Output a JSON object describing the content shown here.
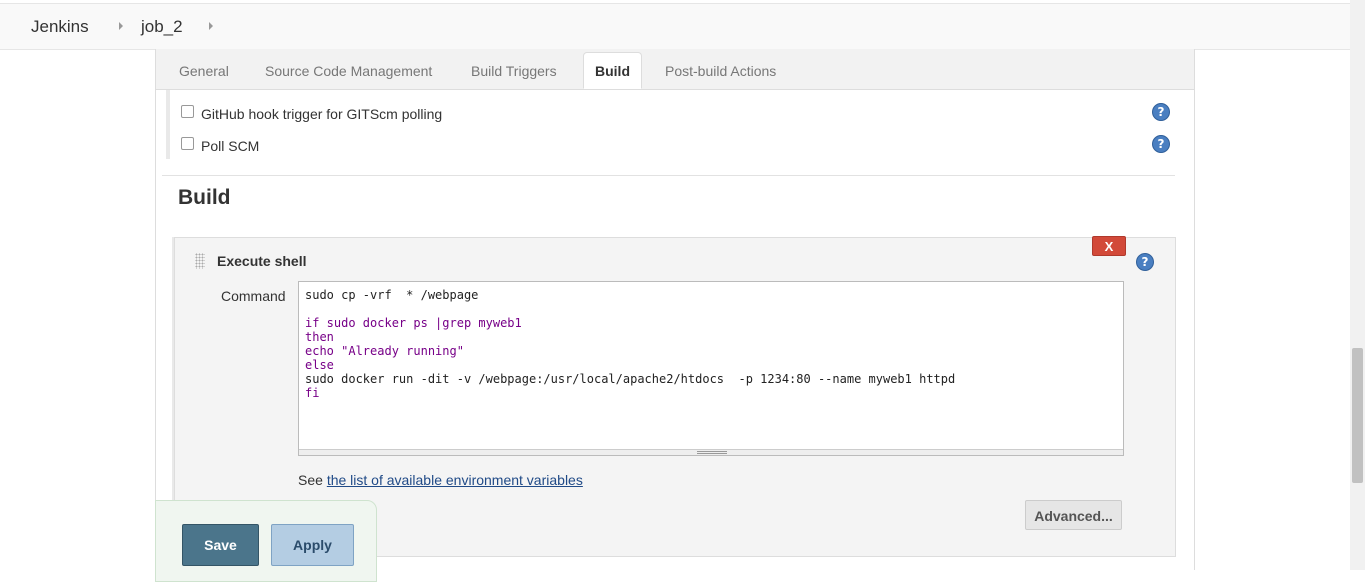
{
  "breadcrumb": {
    "items": [
      "Jenkins",
      "job_2"
    ]
  },
  "tabs": [
    "General",
    "Source Code Management",
    "Build Triggers",
    "Build",
    "Post-build Actions"
  ],
  "active_tab": "Build",
  "triggers": [
    {
      "label": "GitHub hook trigger for GITScm polling",
      "checked": false
    },
    {
      "label": "Poll SCM",
      "checked": false
    }
  ],
  "build": {
    "section_title": "Build",
    "step_title": "Execute shell",
    "delete_label": "X",
    "command_label": "Command",
    "command_lines": [
      "sudo cp -vrf  * /webpage",
      "",
      "if sudo docker ps |grep myweb1",
      "then",
      "echo \"Already running\"",
      "else",
      "sudo docker run -dit -v /webpage:/usr/local/apache2/htdocs  -p 1234:80 --name myweb1 httpd",
      "fi"
    ],
    "see_prefix": "See",
    "env_link": "the list of available environment variables",
    "advanced_label": "Advanced..."
  },
  "help_icon_glyph": "?",
  "footer": {
    "save_label": "Save",
    "apply_label": "Apply"
  }
}
